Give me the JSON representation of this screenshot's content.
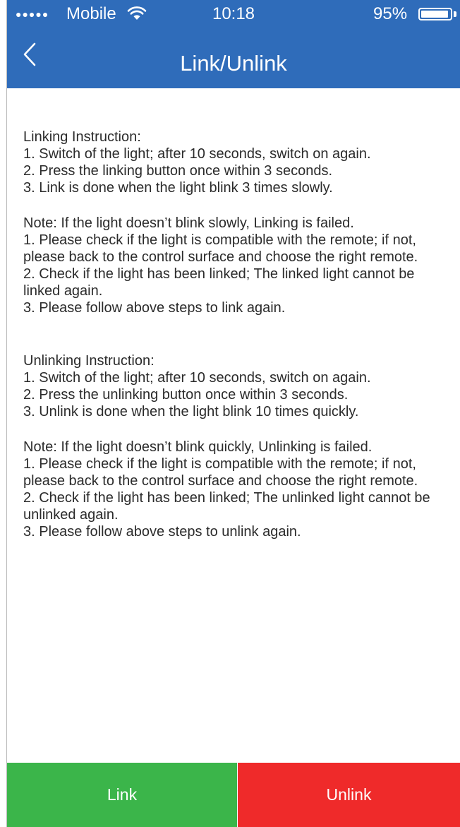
{
  "status_bar": {
    "signal": "●●●●●",
    "carrier": "Mobile",
    "time": "10:18",
    "battery_percent": "95%",
    "battery_level": 0.95,
    "icons": [
      "wifi-icon",
      "battery-icon"
    ]
  },
  "nav": {
    "back_icon": "chevron-left-icon",
    "title": "Link/Unlink"
  },
  "linking": {
    "heading": "Linking Instruction:",
    "steps": [
      "1. Switch of the light; after 10 seconds, switch on again.",
      "2. Press the linking button once within 3 seconds.",
      "3. Link is done when the light blink 3 times slowly."
    ],
    "note": "Note: If the light doesn’t blink slowly, Linking is failed.",
    "note_steps": [
      "1. Please check if the light is compatible with the remote; if not, please back to the control surface and choose the right remote.",
      "2. Check if the light has been linked; The linked light cannot be linked again.",
      "3. Please follow above steps to link again."
    ]
  },
  "unlinking": {
    "heading": "Unlinking Instruction:",
    "steps": [
      "1. Switch of the light; after 10 seconds, switch on again.",
      "2. Press the unlinking button once within 3 seconds.",
      "3. Unlink is done when the light blink 10 times quickly."
    ],
    "note": "Note: If the light doesn’t blink quickly, Unlinking is failed.",
    "note_steps": [
      "1. Please check if the light is compatible with the remote; if not, please back to the control surface and choose the right remote.",
      "2. Check if the light has been linked; The unlinked light cannot be unlinked again.",
      "3. Please follow above steps to unlink again."
    ]
  },
  "buttons": {
    "link_label": "Link",
    "unlink_label": "Unlink"
  },
  "colors": {
    "header": "#2f6cba",
    "link_button": "#3bb54a",
    "unlink_button": "#ef2a2a",
    "text": "#2b2b2b"
  }
}
